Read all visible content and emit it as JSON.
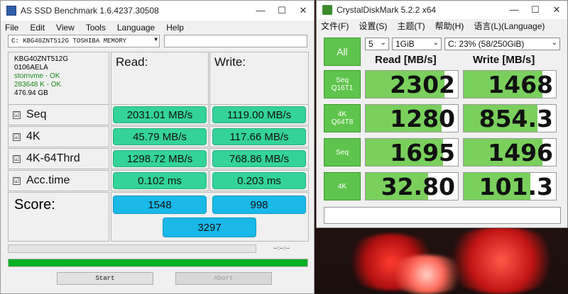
{
  "asssd": {
    "title": "AS SSD Benchmark 1.6.4237.30508",
    "menu": [
      "File",
      "Edit",
      "View",
      "Tools",
      "Language",
      "Help"
    ],
    "drive_select": "C: KBG40ZNT512G TOSHIBA MEMORY",
    "info": {
      "model": "KBG40ZNT512G",
      "firmware": "0106AELA",
      "driver": "stornvme - OK",
      "alignment": "283648 K - OK",
      "size": "476.94 GB"
    },
    "headers": {
      "read": "Read:",
      "write": "Write:"
    },
    "rows": [
      {
        "label": "Seq",
        "read": "2031.01 MB/s",
        "write": "1119.00 MB/s"
      },
      {
        "label": "4K",
        "read": "45.79 MB/s",
        "write": "117.66 MB/s"
      },
      {
        "label": "4K-64Thrd",
        "read": "1298.72 MB/s",
        "write": "768.86 MB/s"
      },
      {
        "label": "Acc.time",
        "read": "0.102 ms",
        "write": "0.203 ms"
      }
    ],
    "score_label": "Score:",
    "score_read": "1548",
    "score_write": "998",
    "score_total": "3297",
    "time": "--:--:--",
    "progress": 1.0,
    "start_label": "Start",
    "abort_label": "Abort",
    "check": "☑"
  },
  "cdm": {
    "title": "CrystalDiskMark 5.2.2 x64",
    "menu": [
      "文件(F)",
      "设置(S)",
      "主题(T)",
      "帮助(H)",
      "语言(L)(Language)"
    ],
    "count": "5",
    "size": "1GiB",
    "drive": "C: 23% (58/250GiB)",
    "all_label": "All",
    "read_header": "Read [MB/s]",
    "write_header": "Write [MB/s]",
    "tests": [
      {
        "l1": "Seq",
        "l2": "Q16T1",
        "read": "2302",
        "write": "1468",
        "read_fill": 0.85,
        "write_fill": 0.85
      },
      {
        "l1": "4K",
        "l2": "Q64T8",
        "read": "1280",
        "write": "854.3",
        "read_fill": 0.82,
        "write_fill": 0.8
      },
      {
        "l1": "Seq",
        "l2": "",
        "read": "1695",
        "write": "1496",
        "read_fill": 0.84,
        "write_fill": 0.85
      },
      {
        "l1": "4K",
        "l2": "",
        "read": "32.80",
        "write": "101.3",
        "read_fill": 0.68,
        "write_fill": 0.72
      }
    ]
  },
  "colors": {
    "as_green": "#34d39a",
    "as_blue": "#1ab9e8",
    "cdm_green": "#5fc44d",
    "progress_green": "#06b025"
  }
}
